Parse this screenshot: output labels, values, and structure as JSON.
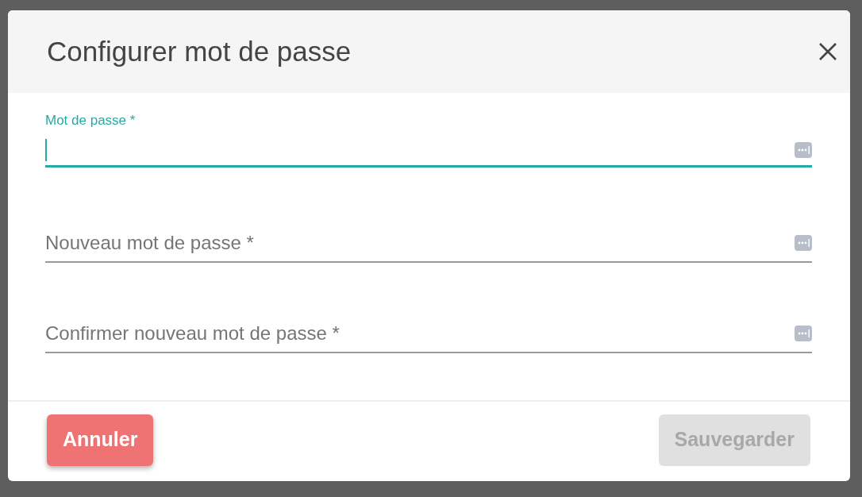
{
  "dialog": {
    "title": "Configurer mot de passe"
  },
  "fields": [
    {
      "label": "Mot de passe *",
      "focused": true
    },
    {
      "label": "Nouveau mot de passe *",
      "focused": false
    },
    {
      "label": "Confirmer nouveau mot de passe *",
      "focused": false
    }
  ],
  "buttons": [
    {
      "label": "Annuler",
      "kind": "cancel",
      "disabled": false
    },
    {
      "label": "Sauvegarder",
      "kind": "save",
      "disabled": true
    }
  ]
}
